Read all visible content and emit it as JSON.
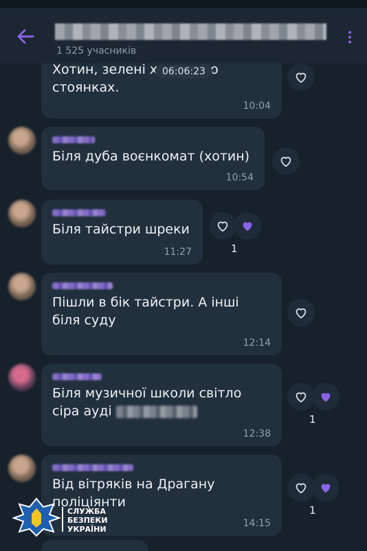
{
  "header": {
    "members": "1 525 учасників"
  },
  "overlay": {
    "timestamp": "06:06:23"
  },
  "messages": [
    {
      "text": "Хотин, зелені ходять по\nстоянках.",
      "time": "10:04"
    },
    {
      "text": "Біля дуба воєнкомат (хотин)",
      "time": "10:54"
    },
    {
      "text": "Біля тайстри шреки",
      "time": "11:27",
      "reaction_count": "1"
    },
    {
      "text": "Пішли в бік тайстри. А інші\nбіля суду",
      "time": "12:14"
    },
    {
      "text": "Біля музичної школи світло\nсіра ауді",
      "time": "12:38",
      "reaction_count": "1"
    },
    {
      "text": "Від вітряків на Драгану\nполіціянти",
      "time": "14:15",
      "reaction_count": "1"
    }
  ],
  "watermark": {
    "line1": "СЛУЖБА",
    "line2": "БЕЗПЕКИ",
    "line3": "УКРАЇНИ"
  },
  "colors": {
    "accent": "#8a63e8",
    "background": "#17212b",
    "bubble": "#222f3d"
  },
  "icons": [
    "back-arrow-icon",
    "more-vertical-icon",
    "heart-outline-icon",
    "heart-filled-icon",
    "ssu-emblem-icon"
  ]
}
